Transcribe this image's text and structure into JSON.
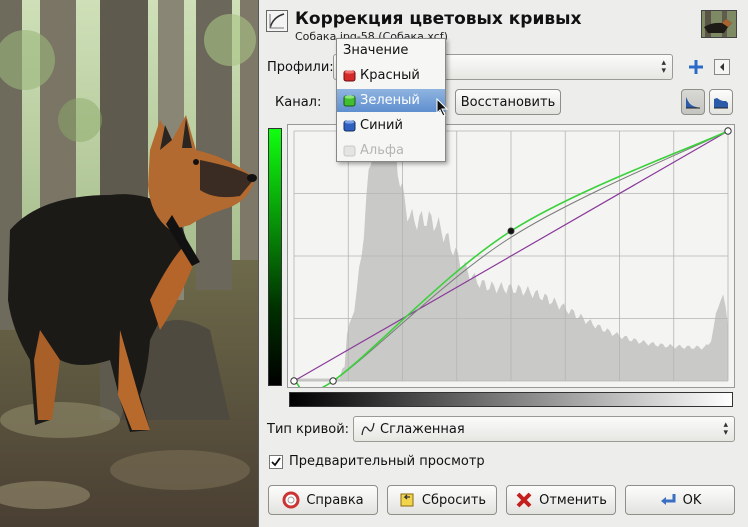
{
  "dialog": {
    "title": "Коррекция цветовых кривых",
    "subtitle": "Собака.jpg-58 (Собака.xcf)"
  },
  "profiles": {
    "label": "Профили:",
    "value": ""
  },
  "channel": {
    "label": "Канал:",
    "reset_button": "Восстановить"
  },
  "channel_menu": {
    "items": [
      {
        "label": "Значение",
        "icon": "none",
        "state": "normal"
      },
      {
        "label": "Красный",
        "icon": "red-can-icon",
        "state": "normal",
        "color": "#d42a2a"
      },
      {
        "label": "Зеленый",
        "icon": "green-can-icon",
        "state": "selected",
        "color": "#3fbf2f"
      },
      {
        "label": "Синий",
        "icon": "blue-can-icon",
        "state": "normal",
        "color": "#2f5fbf"
      },
      {
        "label": "Альфа",
        "icon": "alpha-can-icon",
        "state": "disabled"
      }
    ]
  },
  "curve": {
    "channel_color": "#3ad13a",
    "diagonal_color": "#8a3a9a",
    "points": [
      [
        0,
        0
      ],
      [
        0.09,
        0
      ],
      [
        0.5,
        0.6
      ],
      [
        1,
        1
      ]
    ]
  },
  "curve_type": {
    "label": "Тип кривой:",
    "value": "Сглаженная"
  },
  "preview": {
    "label": "Предварительный просмотр",
    "checked": true
  },
  "buttons": {
    "help": "Справка",
    "reset": "Сбросить",
    "cancel": "Отменить",
    "ok": "OK"
  },
  "colors": {
    "dialog_bg": "#ededeb",
    "menu_selected": "#6f9ad6"
  }
}
